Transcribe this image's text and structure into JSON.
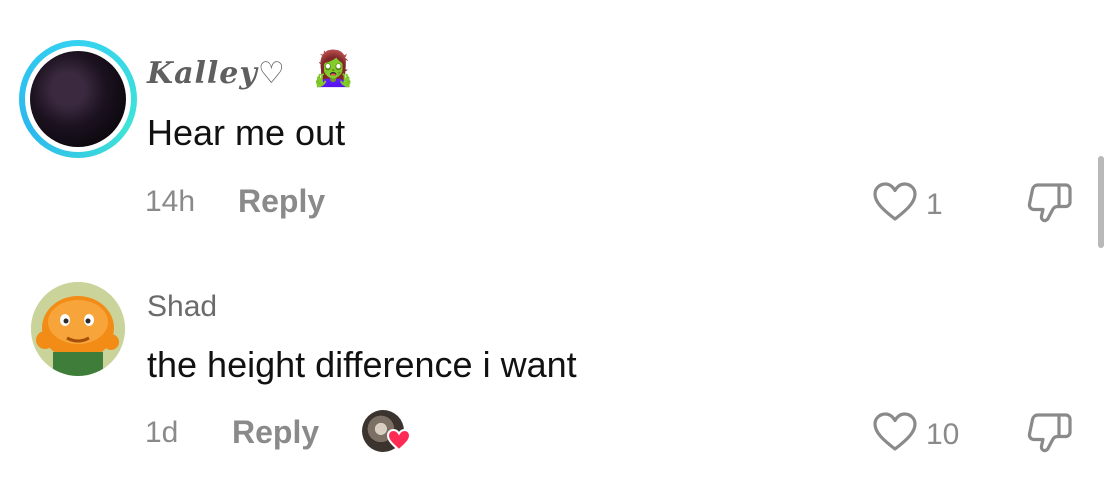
{
  "comments": [
    {
      "username": "Kalley♡",
      "emoji": "🧟‍♀️",
      "text": "Hear me out",
      "time": "14h",
      "reply_label": "Reply",
      "likes": "1",
      "has_story_ring": true
    },
    {
      "username": "Shad",
      "text": "the height difference i want",
      "time": "1d",
      "reply_label": "Reply",
      "likes": "10",
      "liked_by_creator": true
    }
  ],
  "colors": {
    "story_ring": "#34d2f0",
    "heart_badge": "#fe2c55",
    "meta_text": "#8a8a8a"
  },
  "icons": [
    "heart-outline-icon",
    "dislike-icon",
    "creator-liked-heart-icon"
  ]
}
